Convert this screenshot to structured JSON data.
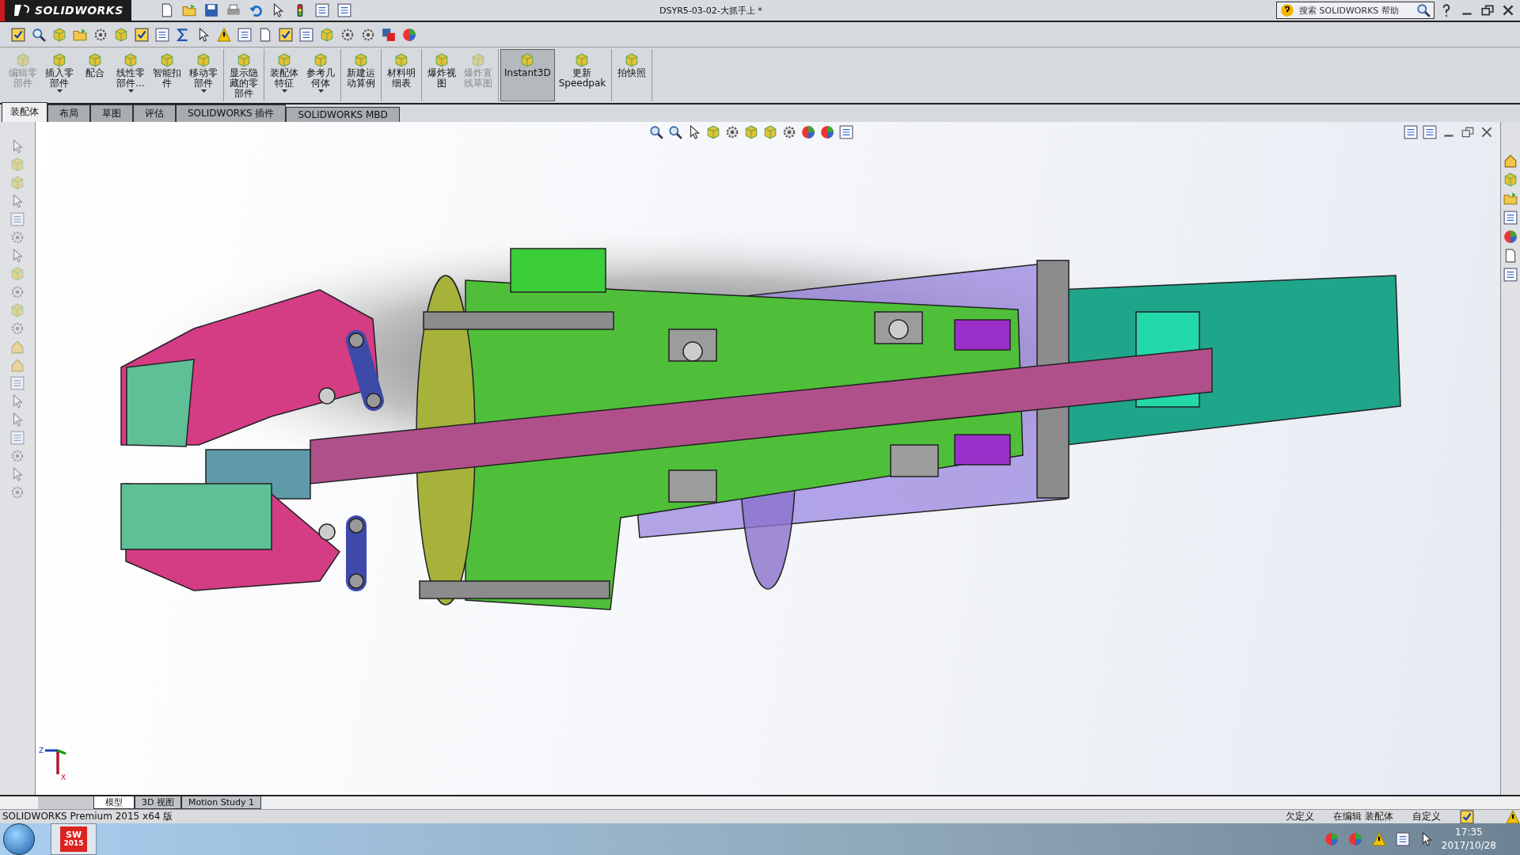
{
  "app": {
    "logo": "SOLIDWORKS",
    "title": "DSYR5-03-02-大抓手上 *",
    "search": {
      "placeholder": "搜索 SOLIDWORKS 帮助"
    }
  },
  "ribbon_groups": [
    [
      {
        "lines": [
          "编辑零",
          "部件"
        ],
        "disabled": true,
        "dropdown": false,
        "selected": false
      },
      {
        "lines": [
          "插入零",
          "部件"
        ],
        "disabled": false,
        "dropdown": true,
        "selected": false
      },
      {
        "lines": [
          "配合"
        ],
        "disabled": false,
        "dropdown": false,
        "selected": false
      },
      {
        "lines": [
          "线性零",
          "部件..."
        ],
        "disabled": false,
        "dropdown": true,
        "selected": false
      },
      {
        "lines": [
          "智能扣",
          "件"
        ],
        "disabled": false,
        "dropdown": false,
        "selected": false
      },
      {
        "lines": [
          "移动零",
          "部件"
        ],
        "disabled": false,
        "dropdown": true,
        "selected": false
      }
    ],
    [
      {
        "lines": [
          "显示隐",
          "藏的零",
          "部件"
        ],
        "disabled": false,
        "dropdown": false,
        "selected": false
      }
    ],
    [
      {
        "lines": [
          "装配体",
          "特征"
        ],
        "disabled": false,
        "dropdown": true,
        "selected": false
      },
      {
        "lines": [
          "参考几",
          "何体"
        ],
        "disabled": false,
        "dropdown": true,
        "selected": false
      }
    ],
    [
      {
        "lines": [
          "新建运",
          "动算例"
        ],
        "disabled": false,
        "dropdown": false,
        "selected": false
      }
    ],
    [
      {
        "lines": [
          "材料明",
          "细表"
        ],
        "disabled": false,
        "dropdown": false,
        "selected": false
      }
    ],
    [
      {
        "lines": [
          "爆炸视",
          "图"
        ],
        "disabled": false,
        "dropdown": false,
        "selected": false
      },
      {
        "lines": [
          "爆炸直",
          "线草图"
        ],
        "disabled": true,
        "dropdown": false,
        "selected": false
      }
    ],
    [
      {
        "lines": [
          "Instant3D"
        ],
        "disabled": false,
        "dropdown": false,
        "selected": true
      },
      {
        "lines": [
          "更新",
          "Speedpak"
        ],
        "disabled": false,
        "dropdown": false,
        "selected": false
      }
    ],
    [
      {
        "lines": [
          "拍快照"
        ],
        "disabled": false,
        "dropdown": false,
        "selected": false
      }
    ]
  ],
  "command_tabs": [
    {
      "label": "装配体",
      "selected": true
    },
    {
      "label": "布局",
      "selected": false
    },
    {
      "label": "草图",
      "selected": false
    },
    {
      "label": "评估",
      "selected": false
    },
    {
      "label": "SOLIDWORKS 插件",
      "selected": false
    },
    {
      "label": "SOLIDWORKS MBD",
      "selected": false
    }
  ],
  "triad": {
    "axis_labels": [
      "Z",
      "X"
    ]
  },
  "document_tabs": [
    {
      "label": "模型",
      "selected": true
    },
    {
      "label": "3D 视图",
      "selected": false
    },
    {
      "label": "Motion Study 1",
      "selected": false
    }
  ],
  "status_bar": {
    "product": "SOLIDWORKS Premium 2015 x64 版",
    "items": [
      "欠定义",
      "在编辑 装配体",
      "自定义"
    ]
  },
  "taskbar": {
    "app_label": "SW",
    "app_version": "2015",
    "time": "17:35",
    "date": "2017/10/28"
  }
}
